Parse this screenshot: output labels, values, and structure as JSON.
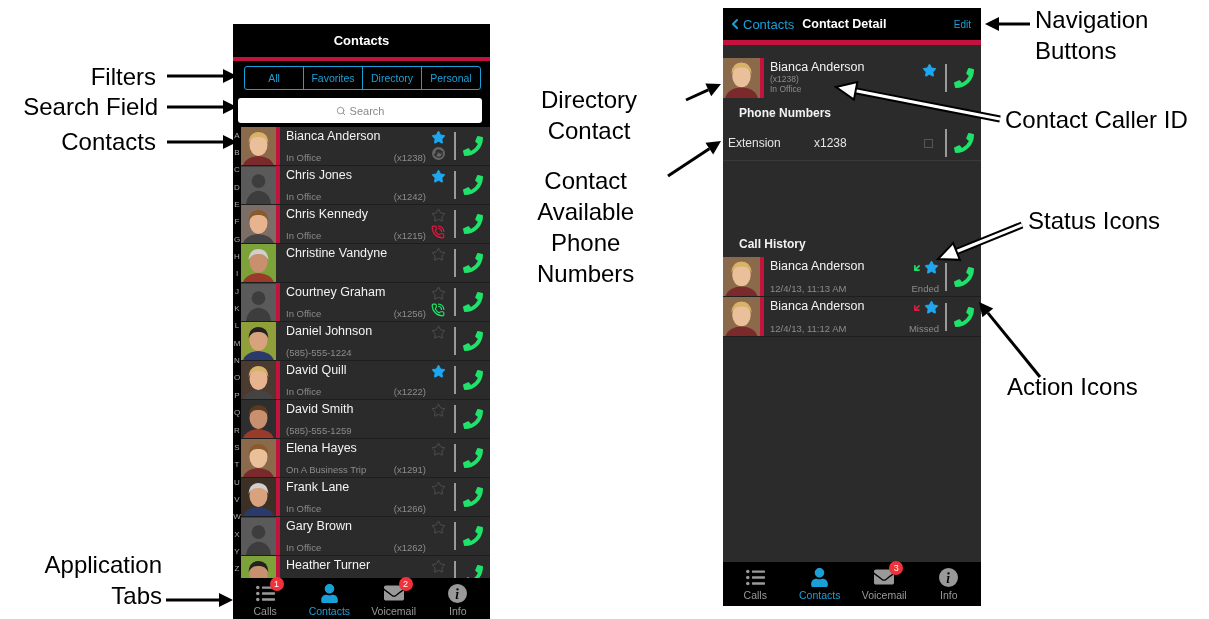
{
  "annotations": [
    {
      "text": "Filters",
      "kind": "solid"
    },
    {
      "text": "Search Field",
      "kind": "solid"
    },
    {
      "text": "Contacts",
      "kind": "solid"
    },
    {
      "text": "Application Tabs",
      "kind": "solid"
    },
    {
      "text": "Directory Contact",
      "kind": "solid"
    },
    {
      "text": "Contact Available Phone Numbers",
      "kind": "solid"
    },
    {
      "text": "Navigation Buttons",
      "kind": "solid"
    },
    {
      "text": "Contact Caller ID",
      "kind": "hollow"
    },
    {
      "text": "Status Icons",
      "kind": "hollow"
    },
    {
      "text": "Action Icons",
      "kind": "solid"
    }
  ],
  "contacts_screen": {
    "title": "Contacts",
    "filters": [
      "All",
      "Favorites",
      "Directory",
      "Personal"
    ],
    "search": {
      "placeholder": "Search"
    },
    "index_letters": [
      "A",
      "B",
      "C",
      "D",
      "E",
      "F",
      "G",
      "H",
      "I",
      "J",
      "K",
      "L",
      "M",
      "N",
      "O",
      "P",
      "Q",
      "R",
      "S",
      "T",
      "U",
      "V",
      "W",
      "X",
      "Y",
      "Z"
    ],
    "contacts": [
      {
        "name": "Bianca Anderson",
        "status": "In Office",
        "extension": "(x1238)",
        "favorite": true,
        "directory": true,
        "status_icon": {
          "kind": "hand"
        }
      },
      {
        "name": "Chris Jones",
        "status": "In Office",
        "extension": "(x1242)",
        "favorite": true,
        "directory": true,
        "kind": "silhouette"
      },
      {
        "name": "Chris Kennedy",
        "status": "In Office",
        "extension": "(x1215)",
        "favorite": false,
        "directory": true,
        "status_icon": {
          "kind": "missed"
        }
      },
      {
        "name": "Christine Vandyne",
        "favorite": false,
        "directory": false
      },
      {
        "name": "Courtney Graham",
        "status": "In Office",
        "extension": "(x1256)",
        "favorite": false,
        "directory": true,
        "kind": "silhouette",
        "status_icon": {
          "kind": "ringing"
        }
      },
      {
        "name": "Daniel Johnson",
        "status": "(585)-555-1224",
        "favorite": false,
        "directory": false
      },
      {
        "name": "David Quill",
        "status": "In Office",
        "extension": "(x1222)",
        "favorite": true,
        "directory": true
      },
      {
        "name": "David Smith",
        "status": "(585)-555-1259",
        "favorite": false,
        "directory": true
      },
      {
        "name": "Elena Hayes",
        "status": "On A Business Trip",
        "extension": "(x1291)",
        "favorite": false,
        "directory": true
      },
      {
        "name": "Frank Lane",
        "status": "In Office",
        "extension": "(x1266)",
        "favorite": false,
        "directory": true
      },
      {
        "name": "Gary Brown",
        "status": "In Office",
        "extension": "(x1262)",
        "favorite": false,
        "directory": true,
        "kind": "silhouette"
      },
      {
        "name": "Heather Turner",
        "favorite": false,
        "directory": true
      }
    ],
    "tabs": [
      {
        "label": "Calls",
        "selected": false,
        "badge": "1",
        "kind": "calls"
      },
      {
        "label": "Contacts",
        "selected": true,
        "kind": "contacts"
      },
      {
        "label": "Voicemail",
        "selected": false,
        "badge": "2",
        "kind": "voicemail"
      },
      {
        "label": "Info",
        "selected": false,
        "kind": "info"
      }
    ]
  },
  "detail_screen": {
    "back": "Contacts",
    "title": "Contact Detail",
    "action": "Edit",
    "contact": {
      "name": "Bianca Anderson",
      "extension": "(x1238)",
      "status": "In Office",
      "favorite": true,
      "directory": true
    },
    "phone_numbers_heading": "Phone Numbers",
    "phone_numbers": [
      {
        "label": "Extension",
        "value": "x1238",
        "checked": false
      }
    ],
    "call_history_heading": "Call History",
    "calls": [
      {
        "name": "Bianca Anderson",
        "time": "12/4/13, 11:13 AM",
        "result": "Ended",
        "kind": "answered",
        "favorite": true
      },
      {
        "name": "Bianca Anderson",
        "time": "12/4/13, 11:12 AM",
        "result": "Missed",
        "kind": "missed",
        "favorite": true
      }
    ],
    "tabs": [
      {
        "label": "Calls",
        "selected": false,
        "kind": "calls"
      },
      {
        "label": "Contacts",
        "selected": true,
        "kind": "contacts"
      },
      {
        "label": "Voicemail",
        "selected": false,
        "badge": "3",
        "kind": "voicemail"
      },
      {
        "label": "Info",
        "selected": false,
        "kind": "info"
      }
    ]
  }
}
